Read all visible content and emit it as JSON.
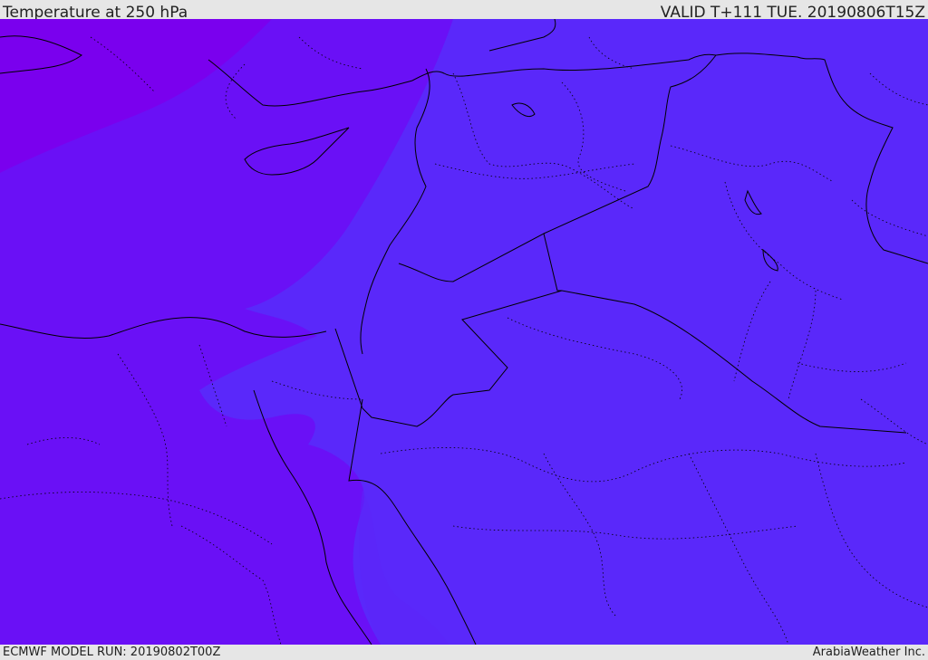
{
  "header": {
    "title": "Temperature at 250 hPa",
    "valid": "VALID T+111 TUE. 20190806T15Z"
  },
  "footer": {
    "model_run": "ECMWF MODEL RUN: 20190802T00Z",
    "credit": "ArabiaWeather Inc."
  },
  "colors": {
    "band_coldest": "#7a00ee",
    "band_cold": "#6a10f6",
    "band_cool": "#5b24f8",
    "band_mild": "#5a28fa",
    "boundary_line": "#000000"
  }
}
